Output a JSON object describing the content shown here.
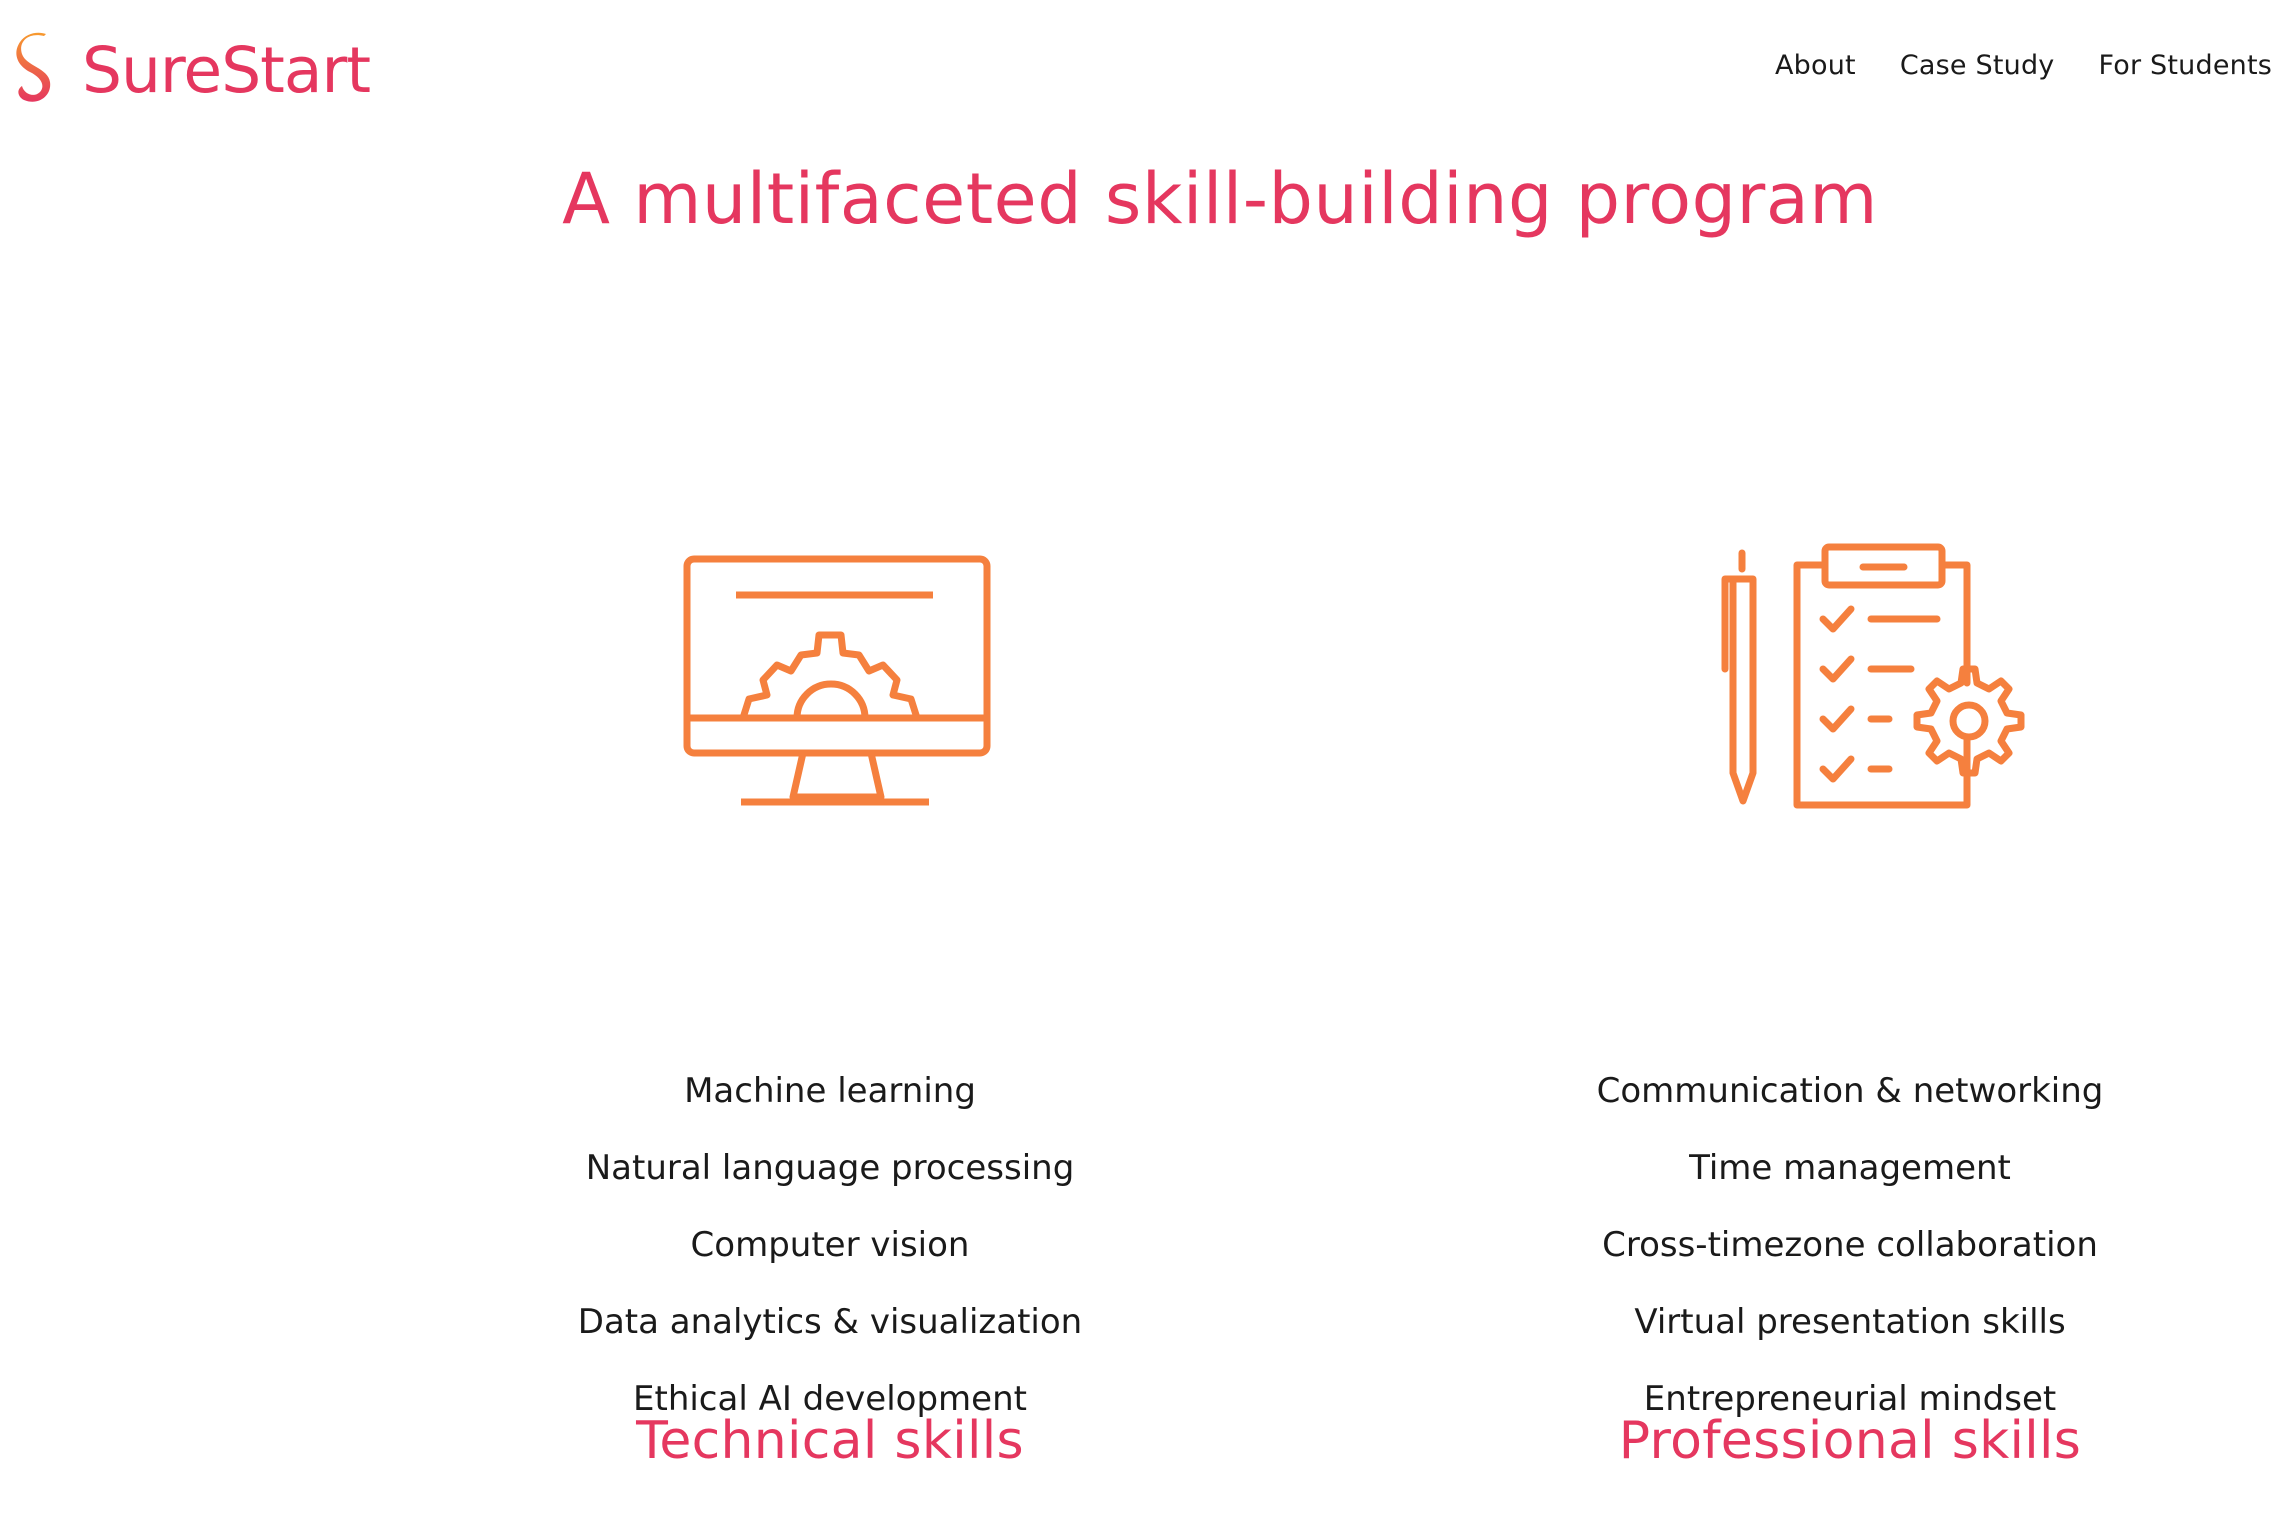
{
  "brand": {
    "name": "SureStart",
    "color": "#e5375f"
  },
  "nav": {
    "items": [
      {
        "label": "About"
      },
      {
        "label": "Case Study"
      },
      {
        "label": "For Students"
      }
    ]
  },
  "page": {
    "title": "A multifaceted skill-building program"
  },
  "sections": [
    {
      "icon": "monitor-gear-icon",
      "heading": "Technical skills",
      "items": [
        "Machine learning",
        "Natural language processing",
        "Computer vision",
        "Data analytics & visualization",
        "Ethical AI development"
      ]
    },
    {
      "icon": "clipboard-checklist-gear-icon",
      "heading": "Professional skills",
      "items": [
        "Communication & networking",
        "Time management",
        "Cross-timezone collaboration",
        "Virtual presentation skills",
        "Entrepreneurial mindset"
      ]
    }
  ],
  "colors": {
    "accent": "#e5375f",
    "icon": "#f5803e",
    "text": "#1a1a1a"
  }
}
